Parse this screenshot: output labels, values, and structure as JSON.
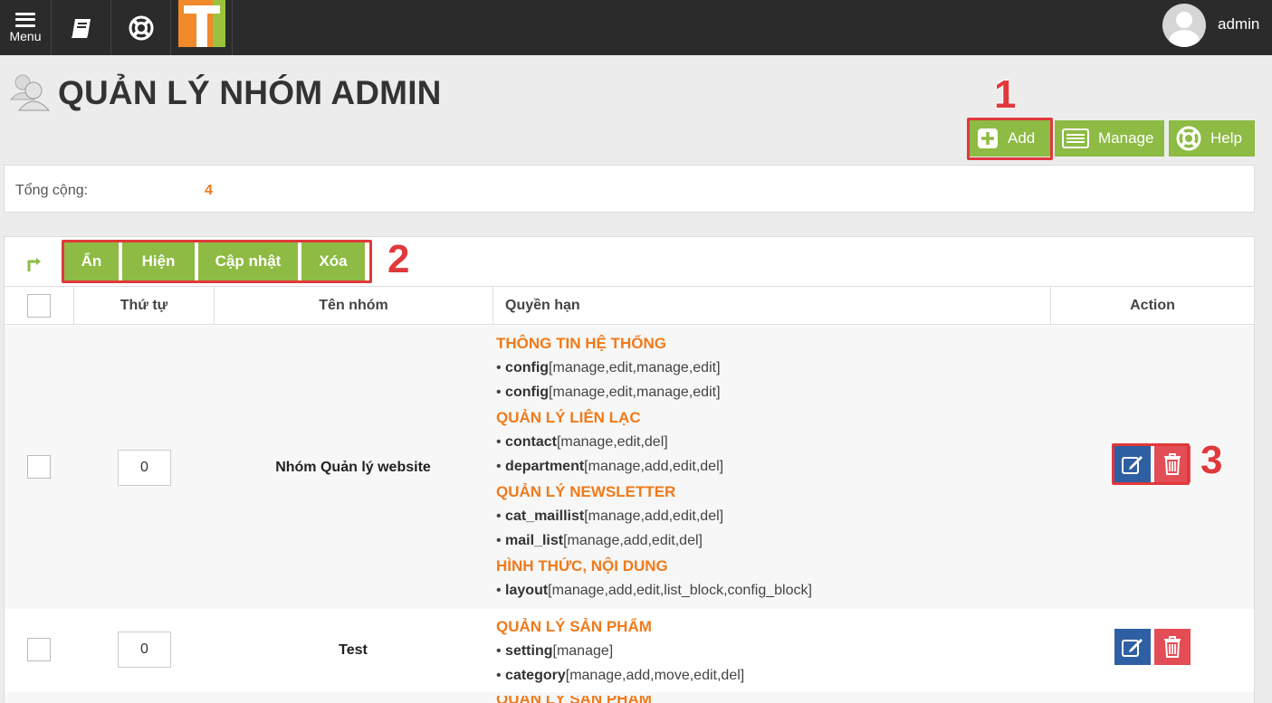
{
  "topbar": {
    "menu_label": "Menu",
    "icons": [
      "menu-icon",
      "book-icon",
      "lifebuoy-icon"
    ],
    "username": "admin"
  },
  "page": {
    "title": "QUẢN LÝ NHÓM ADMIN"
  },
  "actions": {
    "add": "Add",
    "manage": "Manage",
    "help": "Help"
  },
  "annotations": [
    "1",
    "2",
    "3"
  ],
  "summary": {
    "label": "Tổng cộng:",
    "value": "4"
  },
  "bulk_actions": [
    "Ẩn",
    "Hiện",
    "Cập nhật",
    "Xóa"
  ],
  "table": {
    "headers": {
      "order": "Thứ tự",
      "name": "Tên nhóm",
      "permissions": "Quyền hạn",
      "action": "Action"
    },
    "rows": [
      {
        "order": "0",
        "name": "Nhóm Quản lý website",
        "perms": [
          {
            "section": "THÔNG TIN HỆ THỐNG",
            "items": [
              {
                "module": "config",
                "rights": "[manage,edit,manage,edit]"
              },
              {
                "module": "config",
                "rights": "[manage,edit,manage,edit]"
              }
            ]
          },
          {
            "section": "QUẢN LÝ LIÊN LẠC",
            "items": [
              {
                "module": "contact",
                "rights": "[manage,edit,del]"
              },
              {
                "module": "department",
                "rights": "[manage,add,edit,del]"
              }
            ]
          },
          {
            "section": "QUẢN LÝ NEWSLETTER",
            "items": [
              {
                "module": "cat_maillist",
                "rights": "[manage,add,edit,del]"
              },
              {
                "module": "mail_list",
                "rights": "[manage,add,edit,del]"
              }
            ]
          },
          {
            "section": "HÌNH THỨC, NỘI DUNG",
            "items": [
              {
                "module": "layout",
                "rights": "[manage,add,edit,list_block,config_block]"
              }
            ]
          }
        ]
      },
      {
        "order": "0",
        "name": "Test",
        "perms": [
          {
            "section": "QUẢN LÝ SẢN PHẨM",
            "items": [
              {
                "module": "setting",
                "rights": "[manage]"
              },
              {
                "module": "category",
                "rights": "[manage,add,move,edit,del]"
              }
            ]
          }
        ]
      }
    ],
    "partial_row_section": "QUẢN LÝ SẢN PHẨM"
  },
  "colors": {
    "topbar": "#2b2b2b",
    "green": "#8dbb43",
    "orange": "#f07a1a",
    "edit_blue": "#2f5fa3",
    "delete_red": "#e34d55",
    "annotation_red": "#e0393b"
  }
}
